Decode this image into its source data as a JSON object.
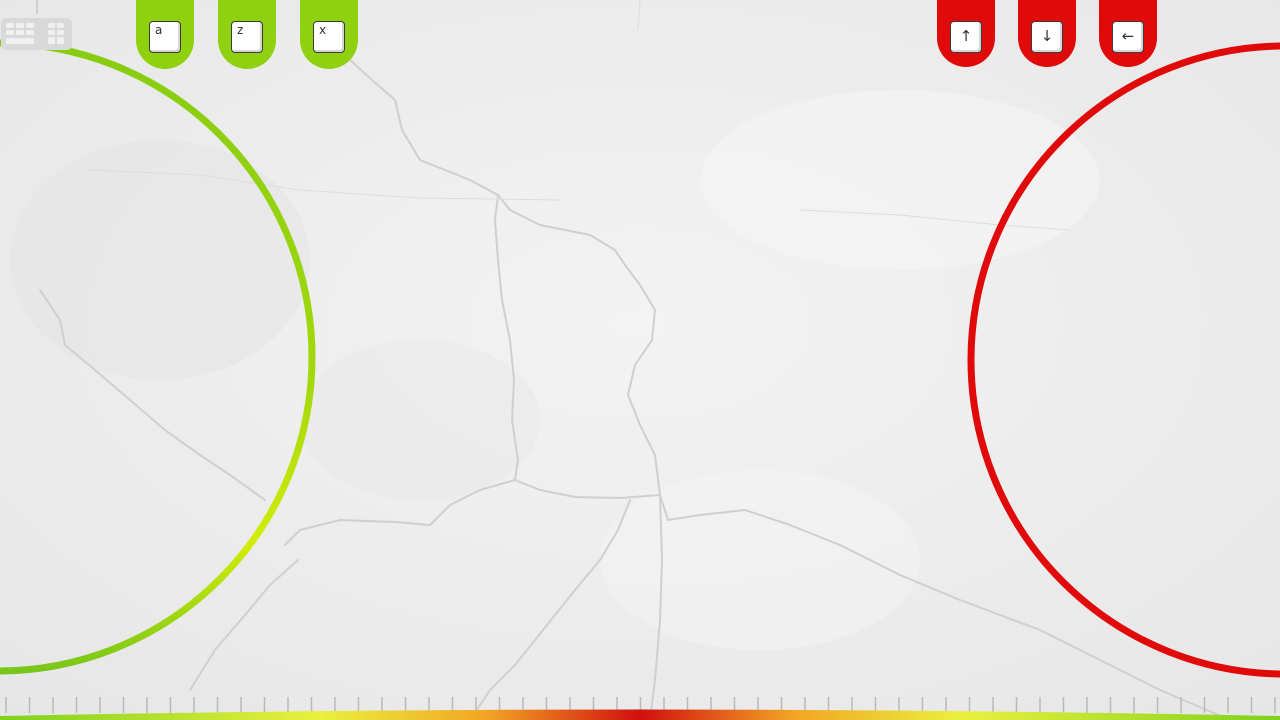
{
  "left_player": {
    "color": "#8fd10e",
    "keys": [
      {
        "label": "a",
        "icon": "key-a-icon"
      },
      {
        "label": "z",
        "icon": "key-z-icon"
      },
      {
        "label": "x",
        "icon": "key-x-icon"
      }
    ]
  },
  "right_player": {
    "color": "#e10a0a",
    "keys": [
      {
        "label": "↑",
        "icon": "arrow-up-key-icon"
      },
      {
        "label": "↓",
        "icon": "arrow-down-key-icon"
      },
      {
        "label": "←",
        "icon": "arrow-left-key-icon"
      }
    ]
  },
  "keyboard_toggle": {
    "icon": "keyboard-icon"
  },
  "background": {
    "texture": "cracked-concrete",
    "color": "#efefef"
  },
  "meter": {
    "gradient": [
      "#7fd11e",
      "#e8f040",
      "#f0a020",
      "#d10f0f",
      "#f0a020",
      "#e8f040",
      "#7fd11e"
    ]
  }
}
